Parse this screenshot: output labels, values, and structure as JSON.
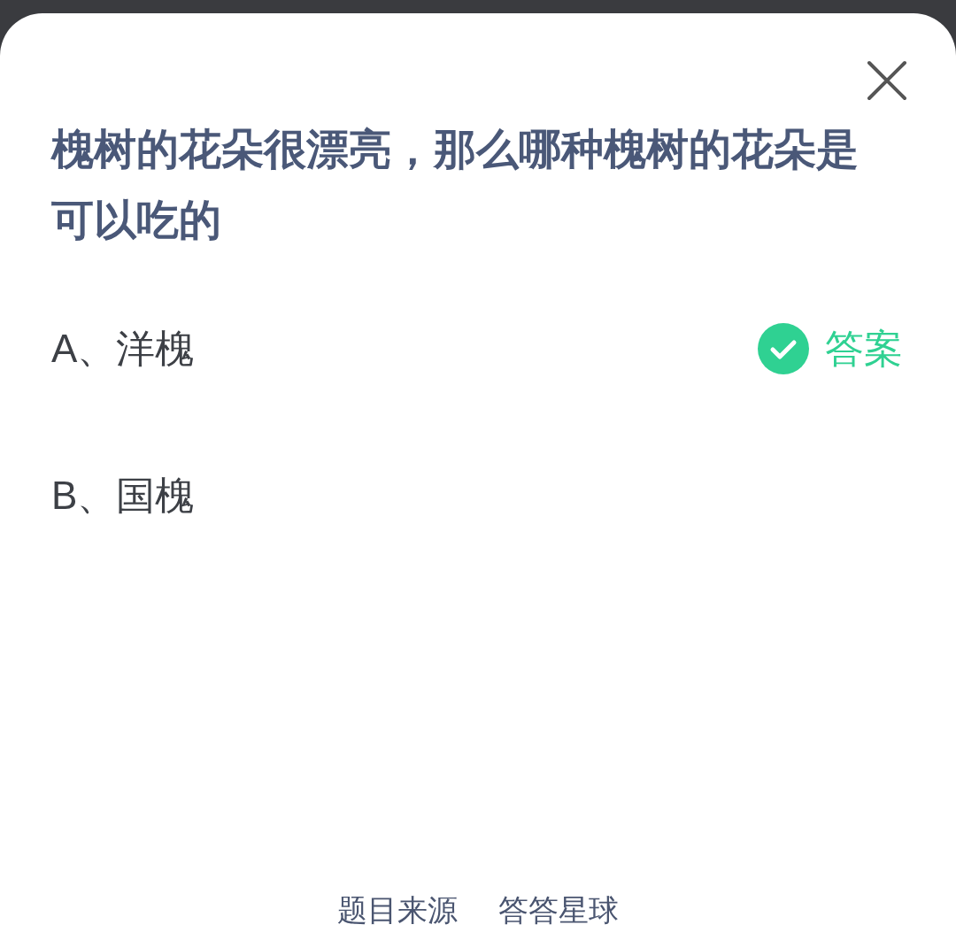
{
  "question": "槐树的花朵很漂亮，那么哪种槐树的花朵是可以吃的",
  "options": [
    {
      "label": "A、洋槐",
      "correct": true,
      "answer_label": "答案"
    },
    {
      "label": "B、国槐",
      "correct": false
    }
  ],
  "footer": {
    "label": "题目来源",
    "source": "答答星球"
  }
}
